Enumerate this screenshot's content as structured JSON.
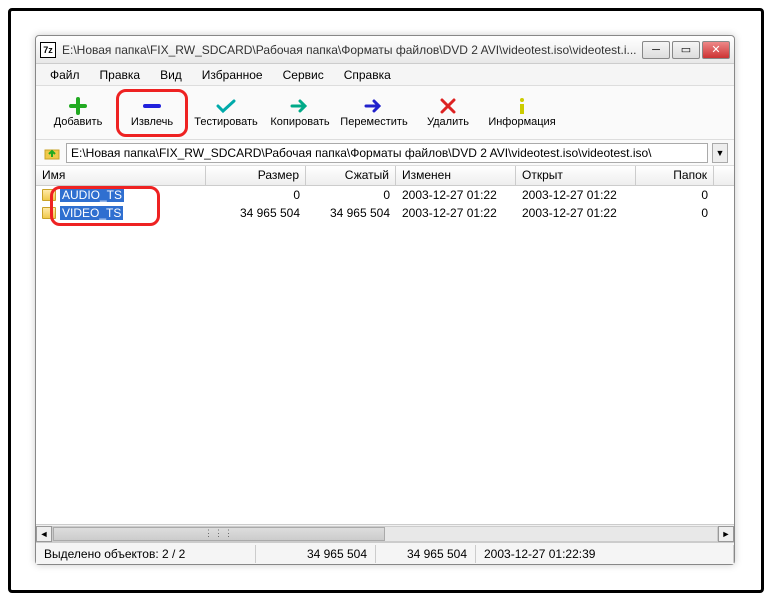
{
  "window": {
    "title": "E:\\Новая папка\\FIX_RW_SDCARD\\Рабочая папка\\Форматы файлов\\DVD 2 AVI\\videotest.iso\\videotest.i...",
    "app_icon_text": "7z"
  },
  "menu": {
    "file": "Файл",
    "edit": "Правка",
    "view": "Вид",
    "favorites": "Избранное",
    "service": "Сервис",
    "help": "Справка"
  },
  "toolbar": {
    "add": "Добавить",
    "extract": "Извлечь",
    "test": "Тестировать",
    "copy": "Копировать",
    "move": "Переместить",
    "delete": "Удалить",
    "info": "Информация"
  },
  "path": "E:\\Новая папка\\FIX_RW_SDCARD\\Рабочая папка\\Форматы файлов\\DVD 2 AVI\\videotest.iso\\videotest.iso\\",
  "columns": {
    "name": "Имя",
    "size": "Размер",
    "packed": "Сжатый",
    "modified": "Изменен",
    "opened": "Открыт",
    "folders": "Папок"
  },
  "rows": [
    {
      "name": "AUDIO_TS",
      "size": "0",
      "packed": "0",
      "modified": "2003-12-27 01:22",
      "opened": "2003-12-27 01:22",
      "folders": "0"
    },
    {
      "name": "VIDEO_TS",
      "size": "34 965 504",
      "packed": "34 965 504",
      "modified": "2003-12-27 01:22",
      "opened": "2003-12-27 01:22",
      "folders": "0"
    }
  ],
  "status": {
    "selection": "Выделено объектов: 2 / 2",
    "size": "34 965 504",
    "packed": "34 965 504",
    "date": "2003-12-27 01:22:39"
  }
}
